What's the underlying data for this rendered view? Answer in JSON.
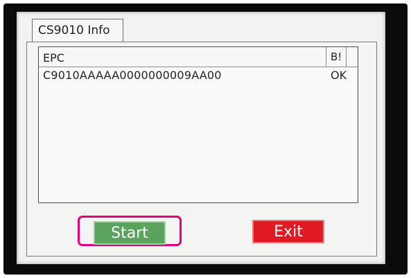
{
  "tab": {
    "label": "CS9010 Info"
  },
  "table": {
    "columns": [
      "EPC",
      "B!"
    ],
    "rows": [
      {
        "epc": "C9010AAAAA0000000009AA00",
        "status": "OK"
      }
    ]
  },
  "buttons": {
    "start_label": "Start",
    "exit_label": "Exit"
  },
  "colors": {
    "start_button": "#5aa35f",
    "exit_button": "#e01a22",
    "highlight": "#e6007e"
  }
}
